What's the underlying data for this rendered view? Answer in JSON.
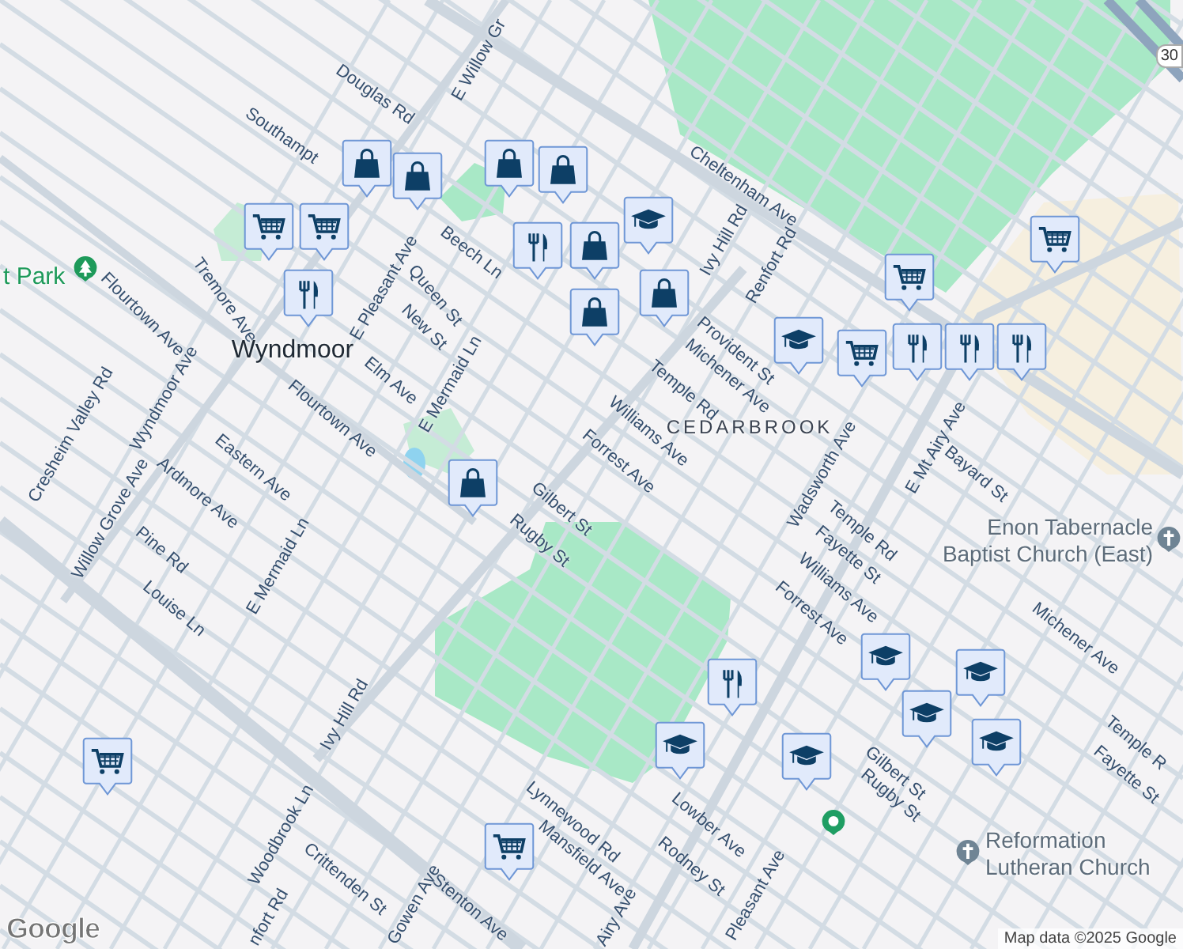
{
  "map": {
    "place_labels": [
      {
        "text": "Wyndmoor",
        "kind": "town"
      },
      {
        "text": "CEDARBROOK",
        "kind": "neighborhood"
      },
      {
        "text": "t Park",
        "kind": "park"
      },
      {
        "text": "Enon Tabernacle Baptist Church (East)",
        "kind": "church"
      },
      {
        "text": "Reformation Lutheran Church",
        "kind": "church"
      }
    ],
    "street_labels": [
      "Douglas Rd",
      "E Willow Gr",
      "Southampt",
      "Cheltenham Ave",
      "Ivy Hill Rd",
      "Beech Ln",
      "Queen St",
      "E Pleasant Ave",
      "Tremore Ave",
      "Flourtown Ave",
      "Wyndmoor Ave",
      "New St",
      "Elm Ave",
      "Flourtown Ave",
      "E Mermaid Ln",
      "Eastern Ave",
      "Ardmore Ave",
      "Cresheim Valley Rd",
      "Willow Grove Ave",
      "Pine Rd",
      "E Mermaid Ln",
      "Louise Ln",
      "Ivy Hill Rd",
      "Woodbrook Ln",
      "Crittenden St",
      "Stenton Ave",
      "Gowen Ave",
      "Lynnewood Rd",
      "Mansfield Ave",
      "Airy Ave",
      "Gilbert St",
      "Rugby St",
      "Forrest Ave",
      "Williams Ave",
      "Temple Rd",
      "Michener Ave",
      "Provident St",
      "Renfort Rd",
      "Wadsworth Ave",
      "E Mt Airy Ave",
      "Bayard St",
      "Temple Rd",
      "Fayette St",
      "Williams Ave",
      "Forrest Ave",
      "Michener Ave",
      "Temple R",
      "Fayette St",
      "Gilbert St",
      "Rugby St",
      "Lowber Ave",
      "Rodney St",
      "Pleasant Ave",
      "nfort Rd"
    ],
    "route_shield": "30",
    "pins": [
      {
        "kind": "shopping"
      },
      {
        "kind": "shopping"
      },
      {
        "kind": "grocery"
      },
      {
        "kind": "grocery"
      },
      {
        "kind": "food"
      },
      {
        "kind": "shopping"
      },
      {
        "kind": "shopping"
      },
      {
        "kind": "shopping"
      },
      {
        "kind": "food"
      },
      {
        "kind": "school"
      },
      {
        "kind": "shopping"
      },
      {
        "kind": "grocery"
      },
      {
        "kind": "school"
      },
      {
        "kind": "grocery"
      },
      {
        "kind": "food"
      },
      {
        "kind": "food"
      },
      {
        "kind": "shopping"
      },
      {
        "kind": "food"
      },
      {
        "kind": "school"
      },
      {
        "kind": "school"
      },
      {
        "kind": "school"
      },
      {
        "kind": "school"
      },
      {
        "kind": "school"
      },
      {
        "kind": "grocery"
      },
      {
        "kind": "grocery"
      },
      {
        "kind": "grocery"
      },
      {
        "kind": "shopping"
      },
      {
        "kind": "food"
      },
      {
        "kind": "school"
      }
    ]
  },
  "attribution": "Map data ©2025 Google",
  "logo": "Google"
}
